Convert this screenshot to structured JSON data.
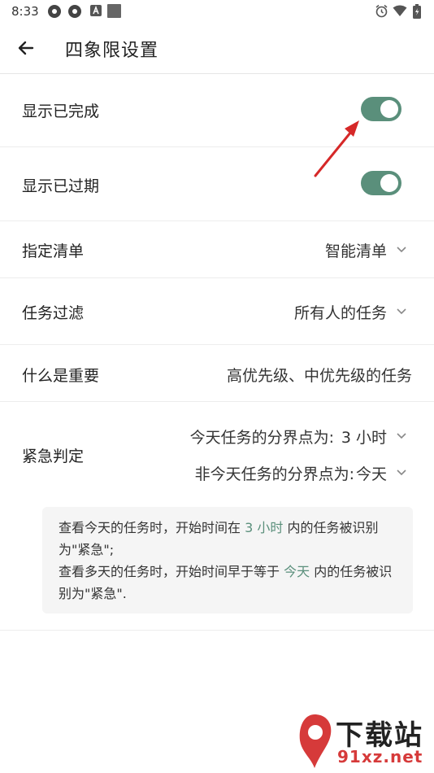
{
  "status_bar": {
    "time": "8:33"
  },
  "app_bar": {
    "title": "四象限设置"
  },
  "settings": {
    "show_completed": {
      "label": "显示已完成",
      "on": true
    },
    "show_overdue": {
      "label": "显示已过期",
      "on": true
    },
    "list": {
      "label": "指定清单",
      "value": "智能清单"
    },
    "task_filter": {
      "label": "任务过滤",
      "value": "所有人的任务"
    },
    "importance": {
      "label": "什么是重要",
      "value": "高优先级、中优先级的任务"
    },
    "urgency": {
      "label": "紧急判定",
      "today_label": "今天任务的分界点为:",
      "today_value": "3 小时",
      "other_label": "非今天任务的分界点为:",
      "other_value": "今天"
    }
  },
  "info": {
    "line1_a": "查看今天的任务时，开始时间在 ",
    "line1_hl": "3 小时",
    "line1_b": " 内的任务被识别为\"紧急\";",
    "line2_a": "查看多天的任务时，开始时间早于等于 ",
    "line2_hl": "今天",
    "line2_b": " 内的任务被识别为\"紧急\"."
  },
  "watermark": {
    "top": "下载站",
    "bottom": "91xz.net"
  },
  "colors": {
    "accent": "#5a8f7b",
    "annotation_arrow": "#d62828"
  }
}
